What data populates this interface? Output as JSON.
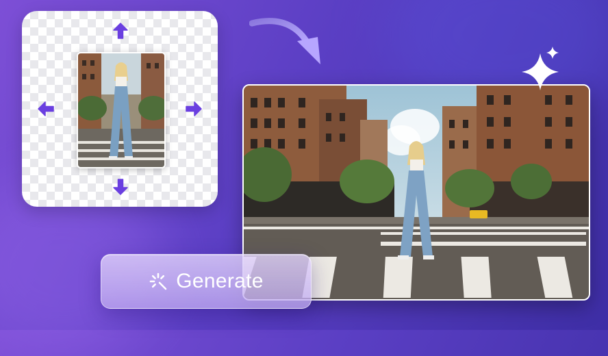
{
  "generate_button": {
    "label": "Generate",
    "icon": "sparkle-burst-icon"
  },
  "icons": {
    "expand_arrows": [
      "arrow-up-icon",
      "arrow-down-icon",
      "arrow-left-icon",
      "arrow-right-icon"
    ],
    "transition": "curved-arrow-icon",
    "decoration": "four-point-star-icon"
  },
  "colors": {
    "background_start": "#7d4fd6",
    "background_end": "#3e2ea6",
    "arrow_accent": "#6a3fe0",
    "button_tint": "#cdb8f3"
  }
}
